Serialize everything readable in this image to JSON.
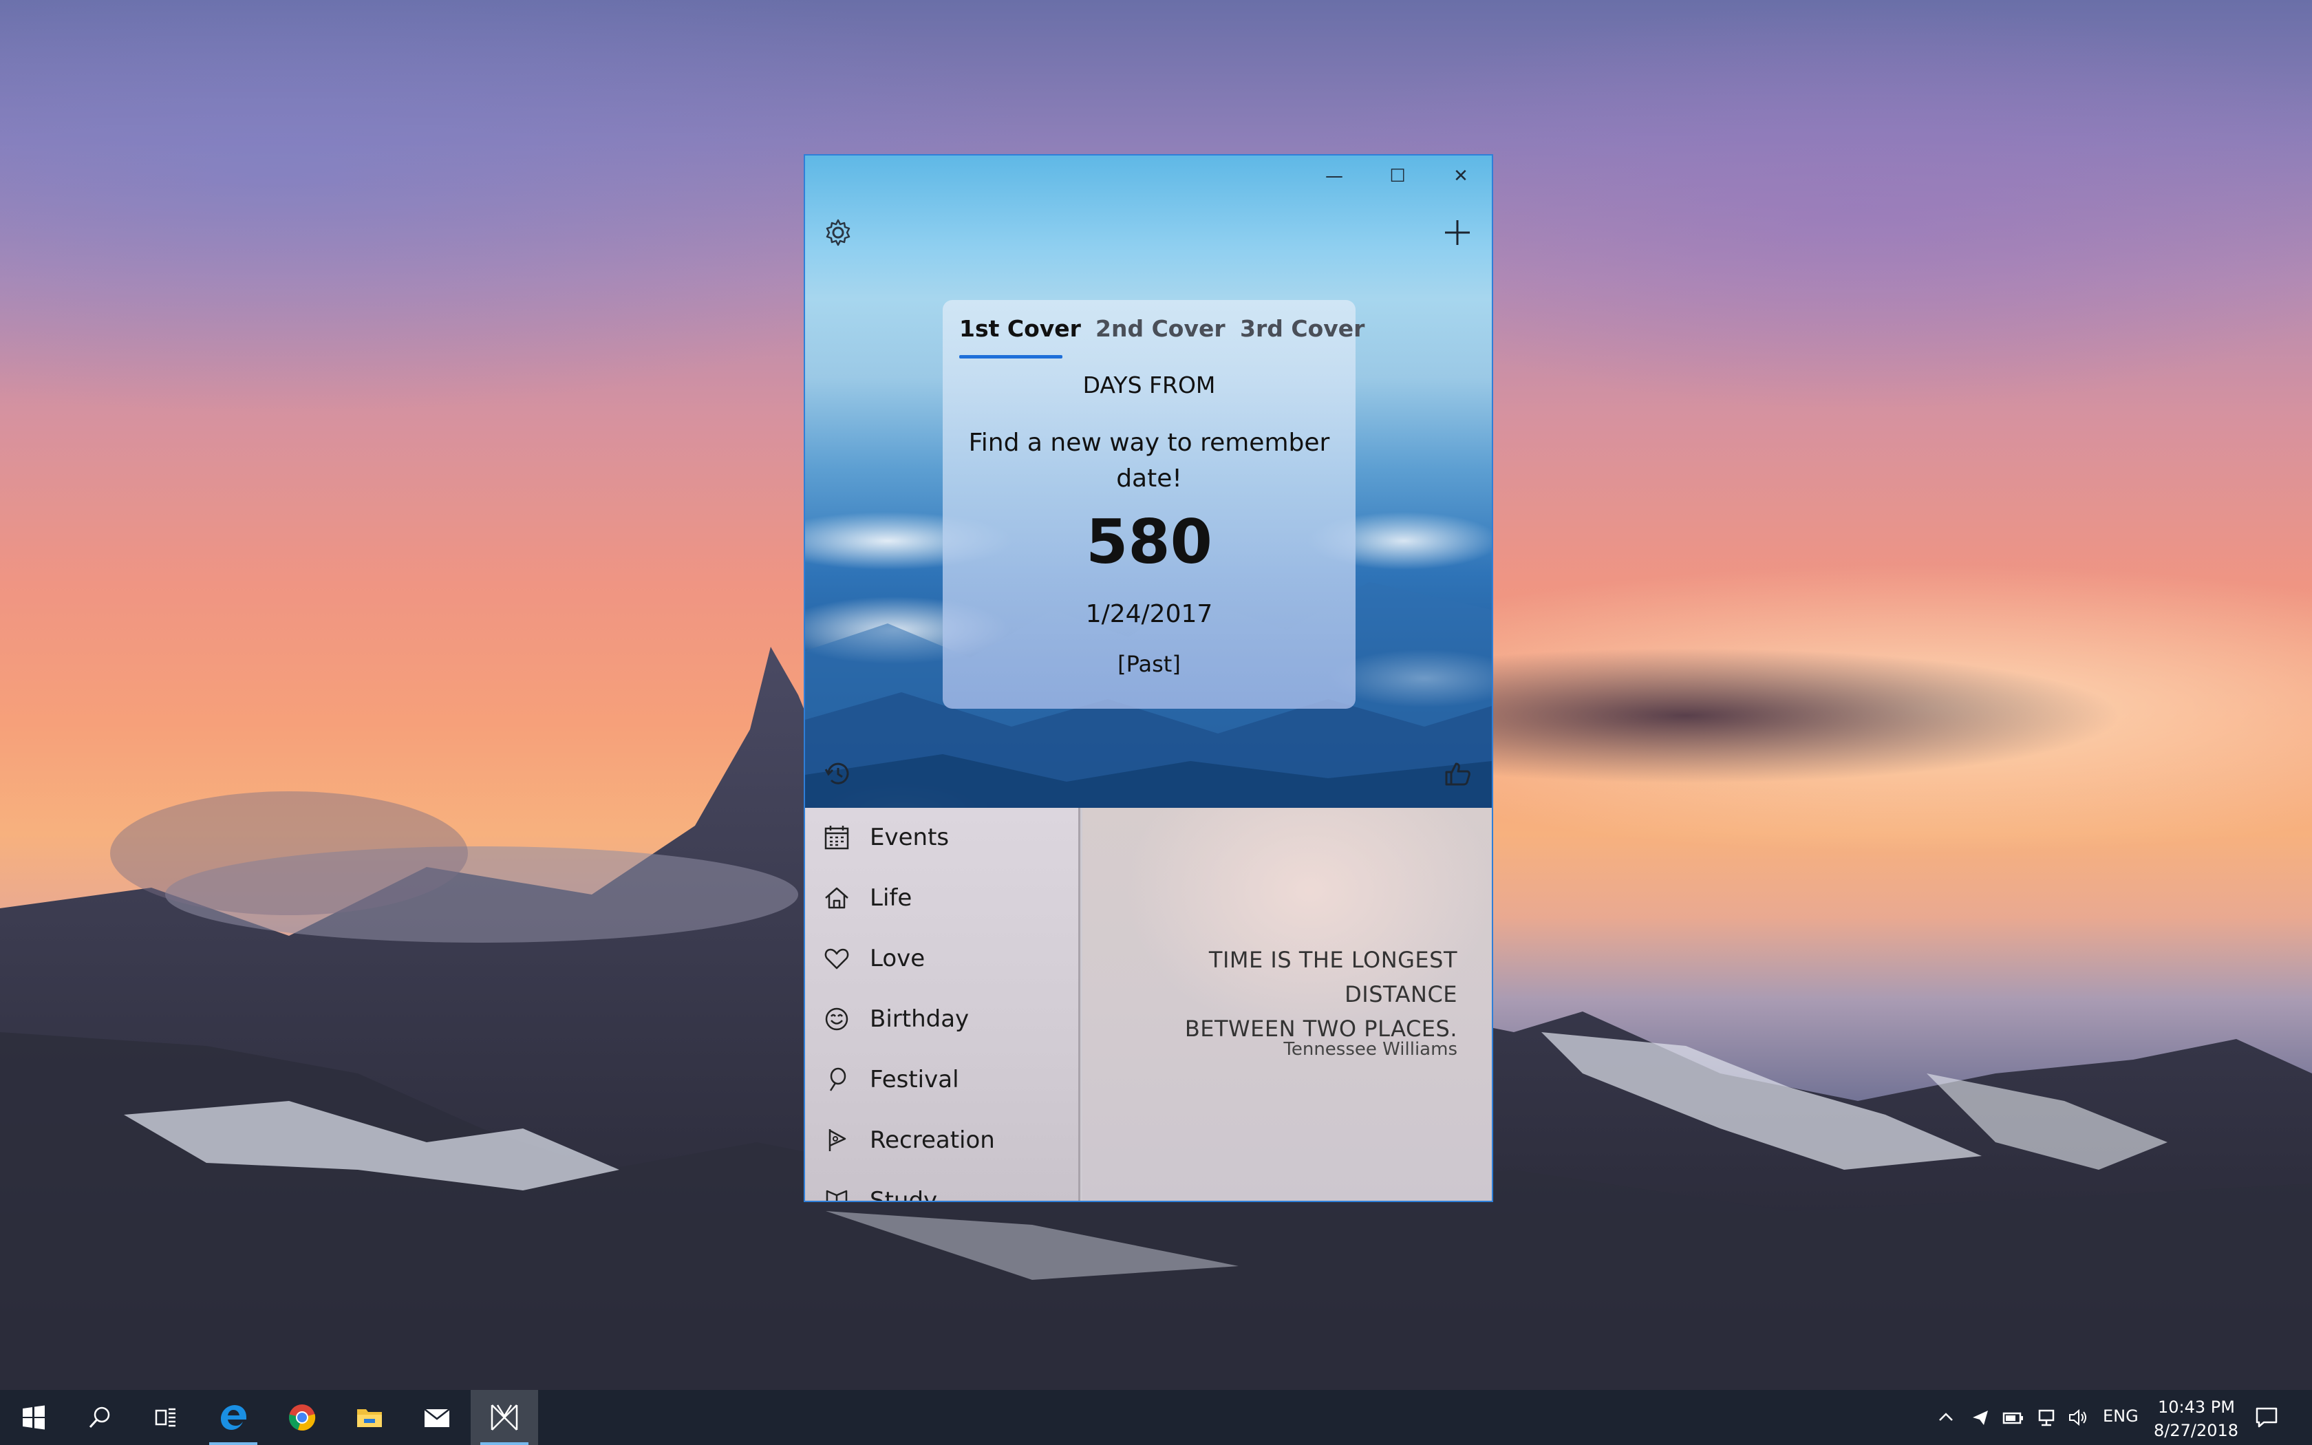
{
  "window": {
    "minimize_glyph": "—",
    "maximize_glyph": "☐",
    "close_glyph": "✕"
  },
  "toolbar": {
    "settings_icon": "gear-icon",
    "add_icon": "plus-icon",
    "history_icon": "history-icon",
    "like_icon": "thumbs-up-icon"
  },
  "cover": {
    "tabs": [
      {
        "label": "1st Cover",
        "active": true
      },
      {
        "label": "2nd Cover",
        "active": false
      },
      {
        "label": "3rd Cover",
        "active": false
      }
    ],
    "heading": "DAYS FROM",
    "title": "Find a new way to remember date!",
    "count": "580",
    "date": "1/24/2017",
    "status": "[Past]"
  },
  "categories": [
    {
      "label": "Events",
      "icon": "calendar-icon"
    },
    {
      "label": "Life",
      "icon": "home-icon"
    },
    {
      "label": "Love",
      "icon": "heart-icon"
    },
    {
      "label": "Birthday",
      "icon": "smiley-icon"
    },
    {
      "label": "Festival",
      "icon": "balloon-icon"
    },
    {
      "label": "Recreation",
      "icon": "flag-icon"
    },
    {
      "label": "Study",
      "icon": "book-icon"
    }
  ],
  "quote": {
    "text_line1": "TIME IS THE LONGEST DISTANCE",
    "text_line2": "BETWEEN TWO PLACES.",
    "author": "Tennessee Williams"
  },
  "taskbar": {
    "apps": [
      "windows-start-icon",
      "search-icon",
      "task-view-icon",
      "edge-icon",
      "chrome-icon",
      "file-explorer-icon",
      "mail-icon",
      "days-app-icon"
    ],
    "language": "ENG",
    "time": "10:43 PM",
    "date": "8/27/2018"
  },
  "colors": {
    "accent": "#1e6fd9",
    "window_border": "#2f7fd8",
    "taskbar": "#1c2330"
  }
}
